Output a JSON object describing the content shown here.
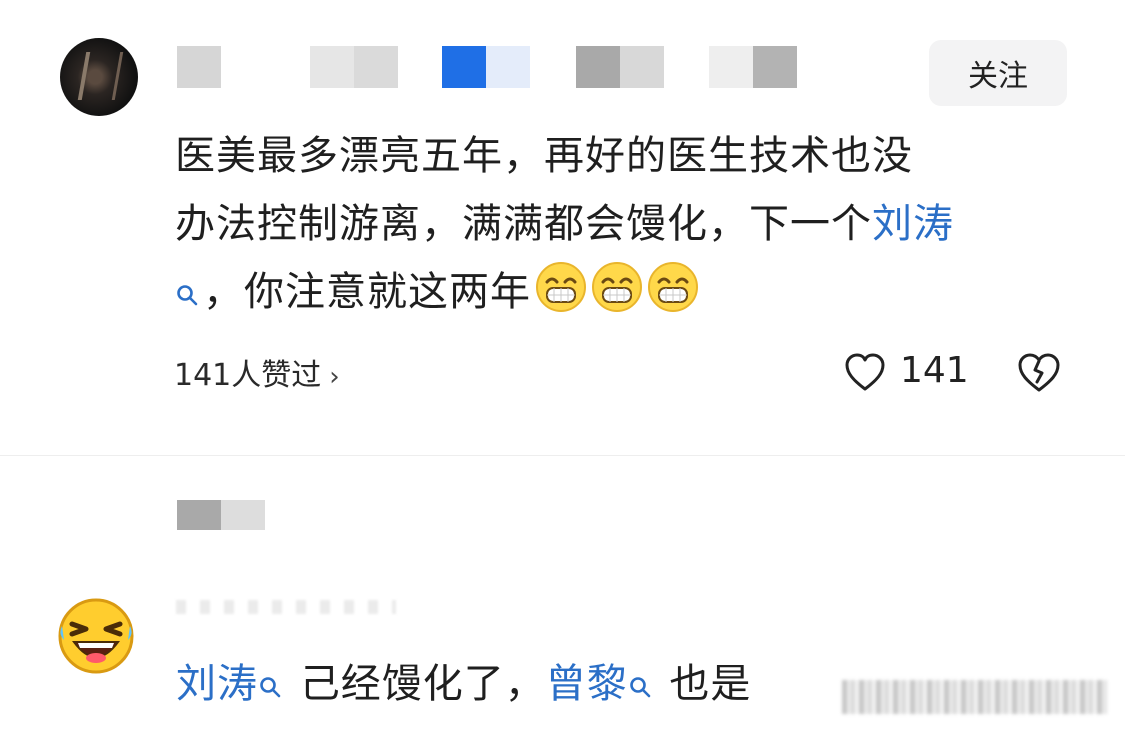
{
  "first_comment": {
    "follow_label": "关注",
    "line1": "医美最多漂亮五年，再好的医生技术也没",
    "line2_prefix": "办法控制游离，满满都会馒化，下一个",
    "line2_mention": "刘涛",
    "line3_text": "，你注意就这两年",
    "emoji_name": "grinning-face-emoji",
    "likes_link": "141人赞过",
    "like_count": "141",
    "accent_color": "#2b6fc7"
  },
  "second_comment": {
    "mention1": "刘涛",
    "text1": " 己经馒化了，",
    "mention2": "曾黎",
    "text2": " 也是"
  },
  "icons": {
    "search": "search-icon",
    "heart": "heart-icon",
    "broken_heart": "broken-heart-icon",
    "chevron": "chevron-right-icon"
  }
}
